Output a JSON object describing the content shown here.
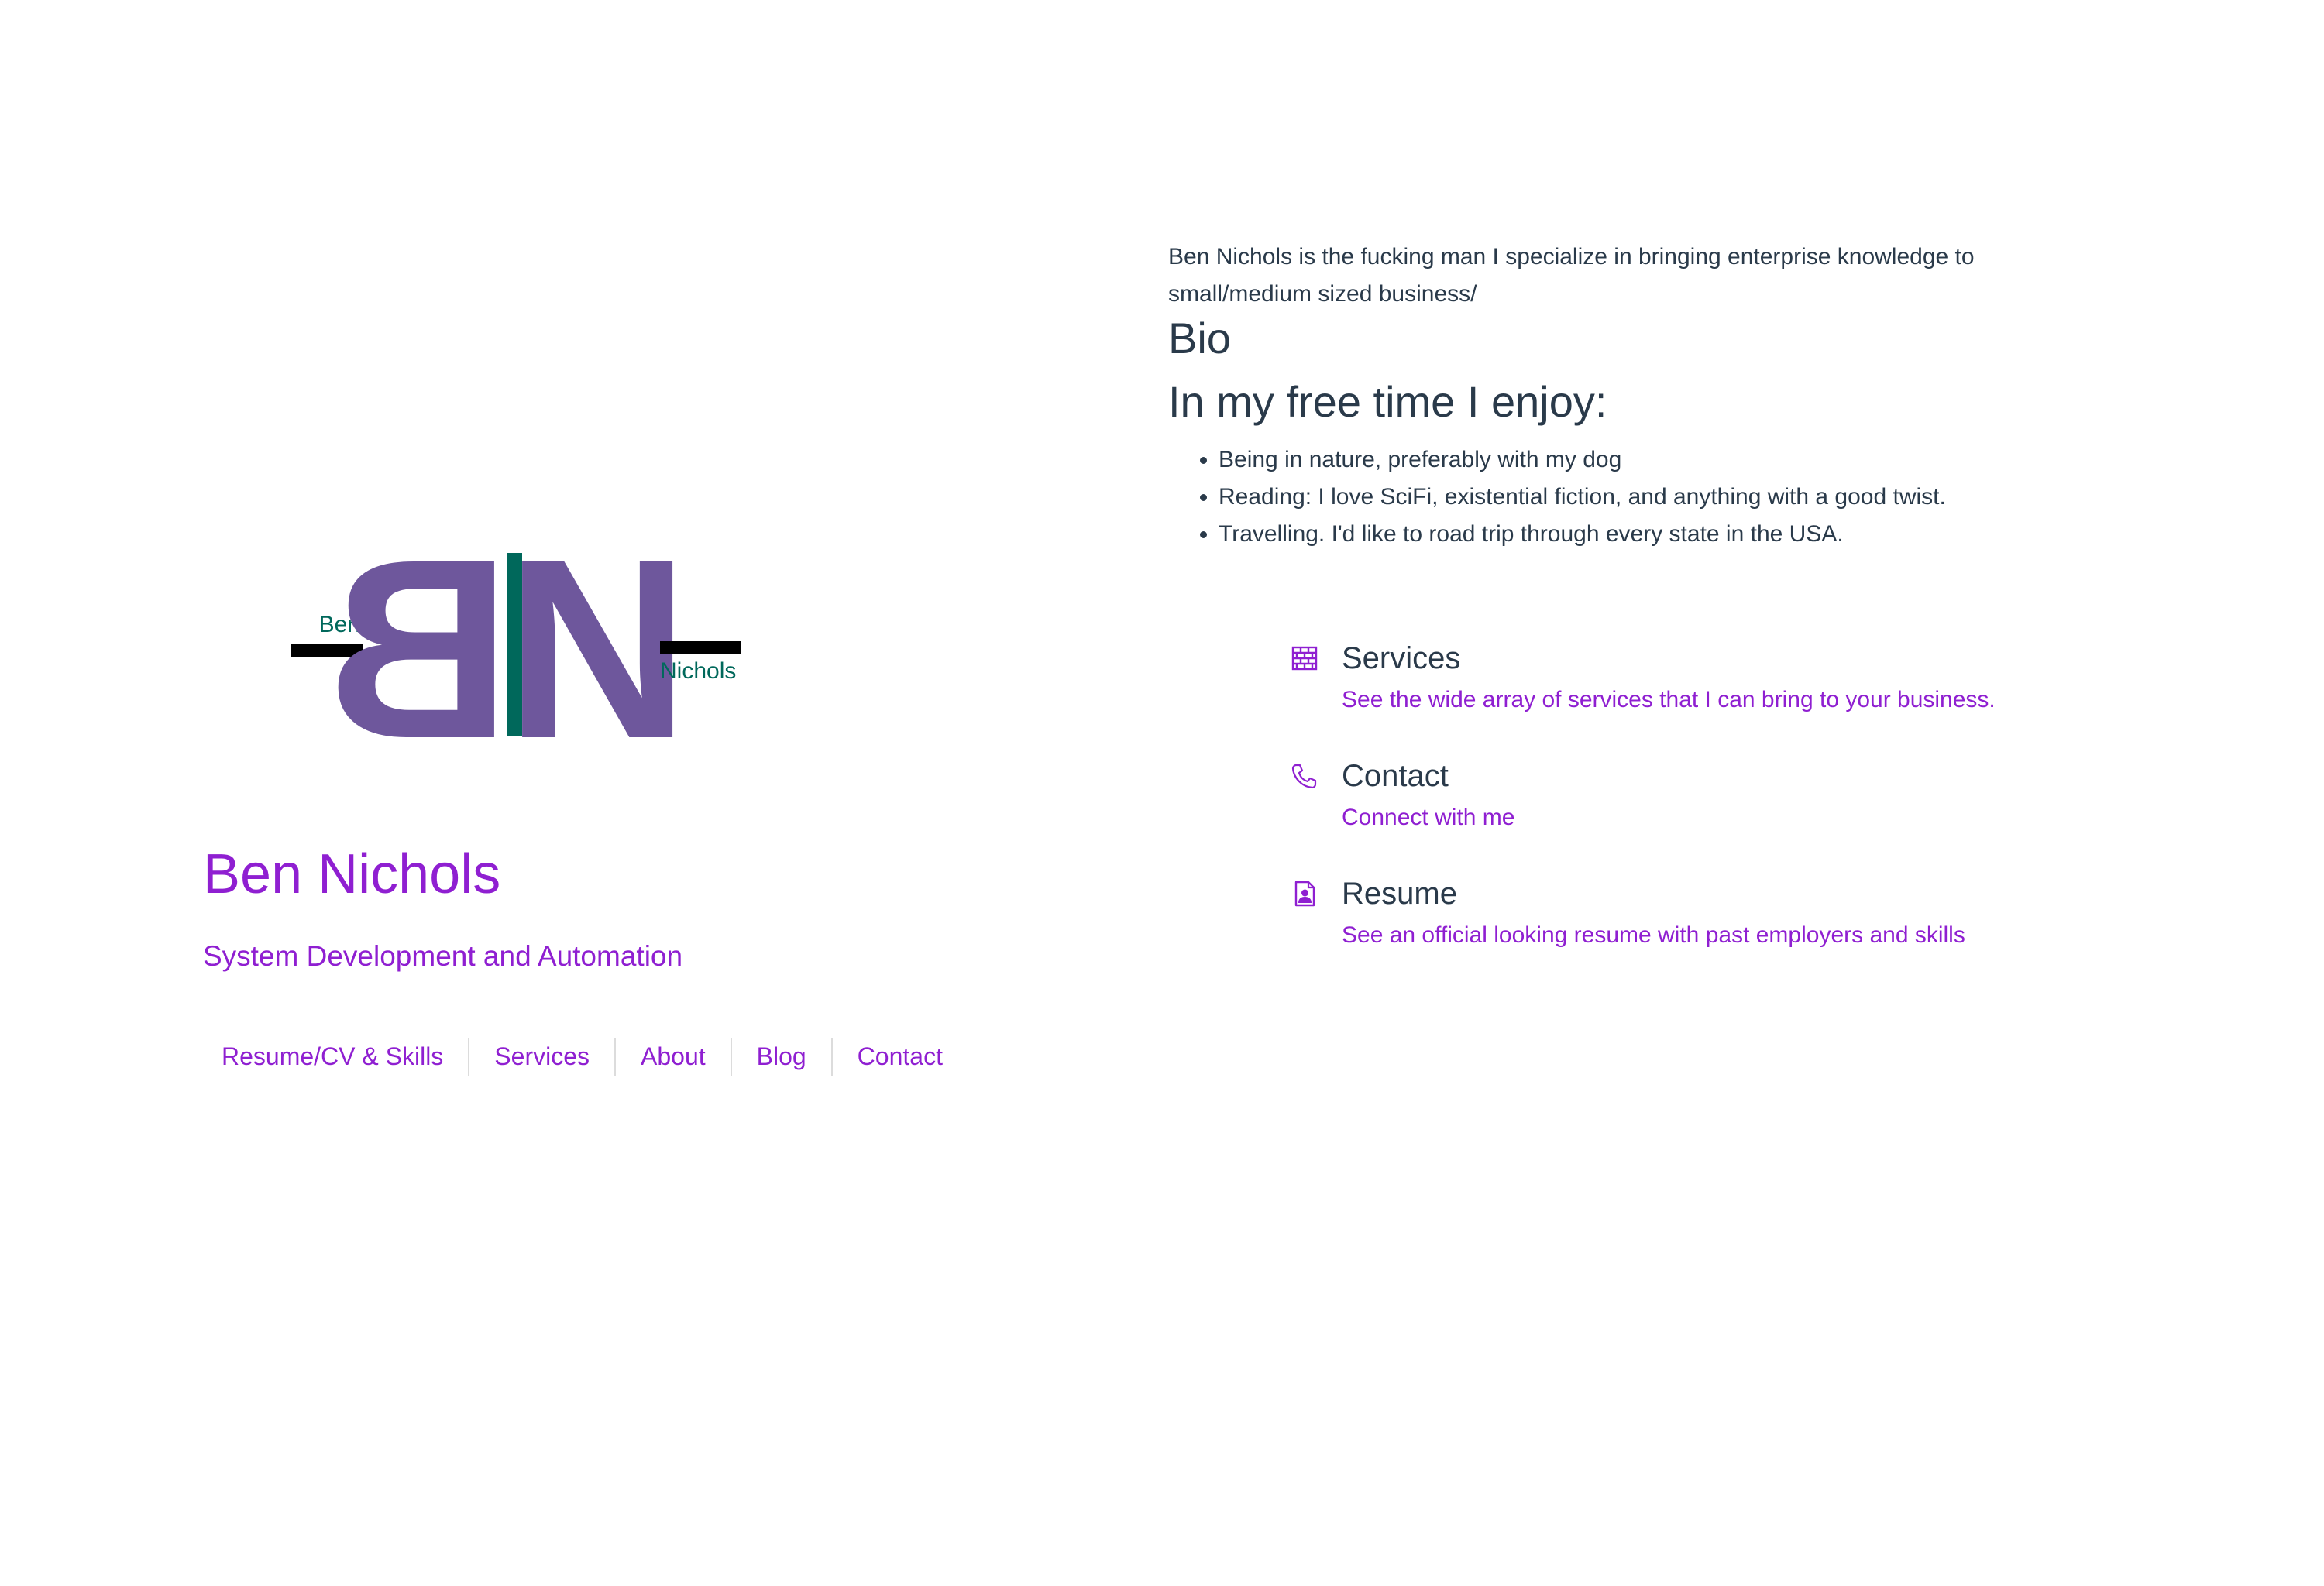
{
  "logo": {
    "mark": "BN",
    "first_name": "Ben",
    "last_name": "Nichols",
    "colors": {
      "mark": "#6e579c",
      "stripe": "#00685b",
      "bars": "#000000",
      "names": "#00685b"
    }
  },
  "identity": {
    "name": "Ben Nichols",
    "tagline": "System Development and Automation"
  },
  "nav": {
    "items": [
      {
        "label": "Resume/CV & Skills"
      },
      {
        "label": "Services"
      },
      {
        "label": "About"
      },
      {
        "label": "Blog"
      },
      {
        "label": "Contact"
      }
    ]
  },
  "bio": {
    "intro": "Ben Nichols is the fucking man I specialize in bringing enterprise knowledge to small/medium sized business/",
    "heading": "Bio",
    "free_time_heading": "In my free time I enjoy:",
    "hobbies": [
      "Being in nature, preferably with my dog",
      "Reading: I love SciFi, existential fiction, and anything with a good twist.",
      "Travelling. I'd like to road trip through every state in the USA."
    ]
  },
  "features": [
    {
      "icon": "bricks-icon",
      "title": "Services",
      "link": "See the wide array of services that I can bring to your business."
    },
    {
      "icon": "phone-icon",
      "title": "Contact",
      "link": "Connect with me"
    },
    {
      "icon": "resume-document-icon",
      "title": "Resume",
      "link": "See an official looking resume with past employers and skills"
    }
  ],
  "colors": {
    "accent": "#8f1fd1",
    "text": "#2a3a4a",
    "divider": "#dcdcdc",
    "background": "#ffffff"
  }
}
